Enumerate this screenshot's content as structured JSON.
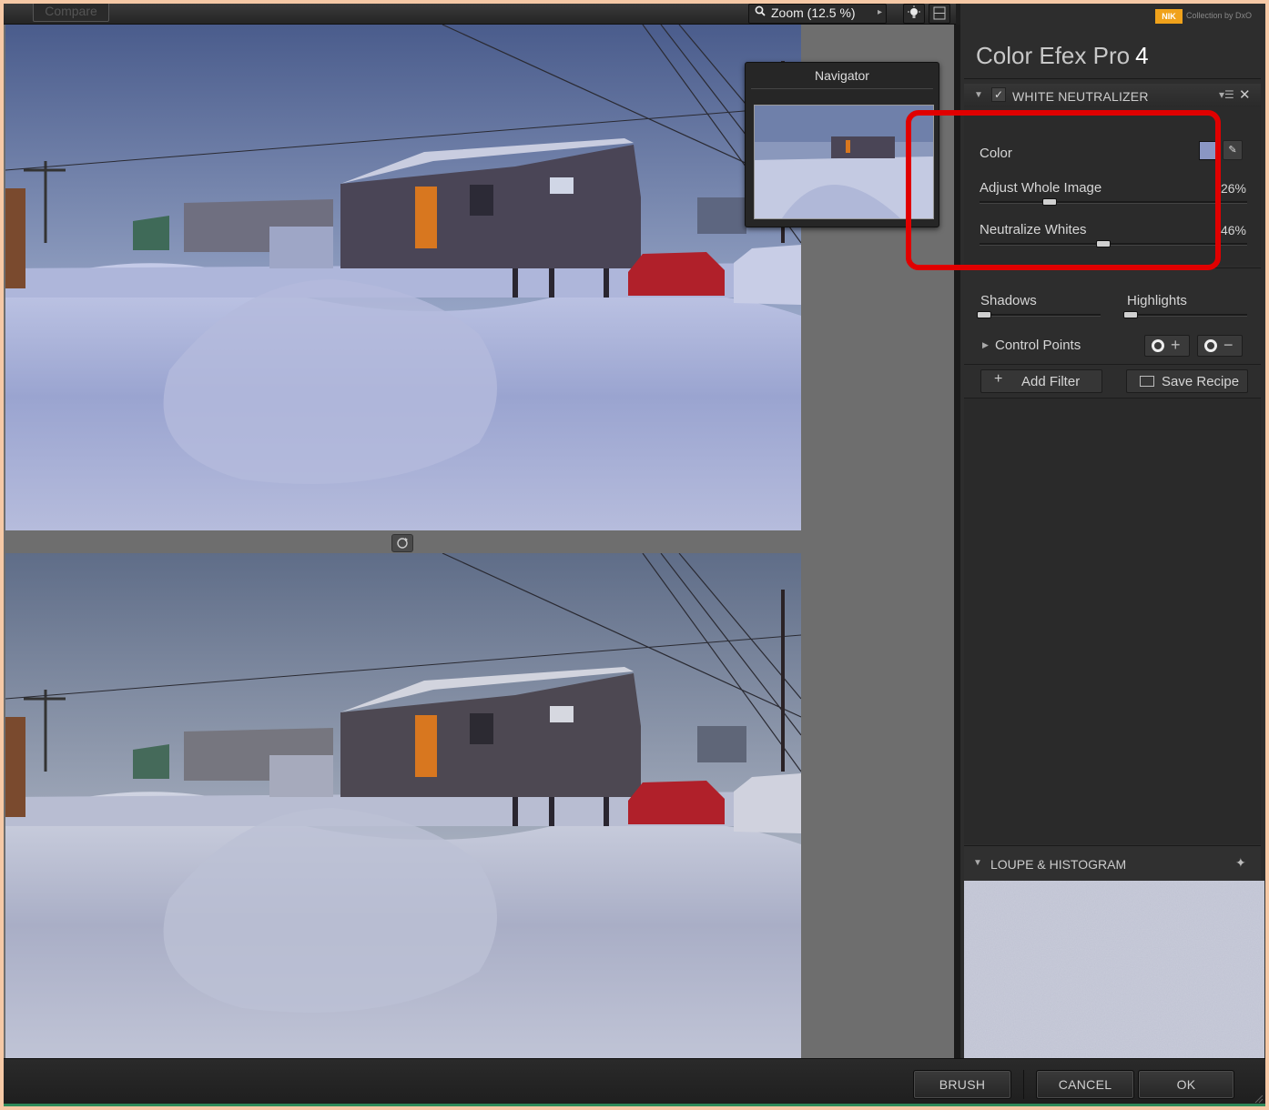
{
  "toolbar": {
    "compare_label": "Compare",
    "zoom_label": "Zoom (12.5 %)"
  },
  "navigator": {
    "title": "Navigator"
  },
  "panel": {
    "brand_badge": "NIK",
    "brand_sub": "Collection by DxO",
    "app_title": "Color Efex Pro",
    "app_version": "4",
    "filter": {
      "name": "WHITE NEUTRALIZER",
      "enabled": true,
      "color_label": "Color",
      "color_value": "#8a96c4",
      "adjust_label": "Adjust Whole Image",
      "adjust_value": "26%",
      "adjust_level": 0.26,
      "neutralize_label": "Neutralize Whites",
      "neutralize_value": "46%",
      "neutralize_level": 0.46,
      "shadows_label": "Shadows",
      "shadows_level": 0.02,
      "highlights_label": "Highlights",
      "highlights_level": 0.02
    },
    "control_points_label": "Control Points",
    "add_filter_label": "Add Filter",
    "save_recipe_label": "Save Recipe",
    "loupe_title": "LOUPE & HISTOGRAM"
  },
  "footer": {
    "brush_label": "BRUSH",
    "cancel_label": "CANCEL",
    "ok_label": "OK"
  },
  "colors": {
    "highlight": "#e00000",
    "brand": "#f0a21b",
    "panel_bg": "#2d2d2d"
  }
}
